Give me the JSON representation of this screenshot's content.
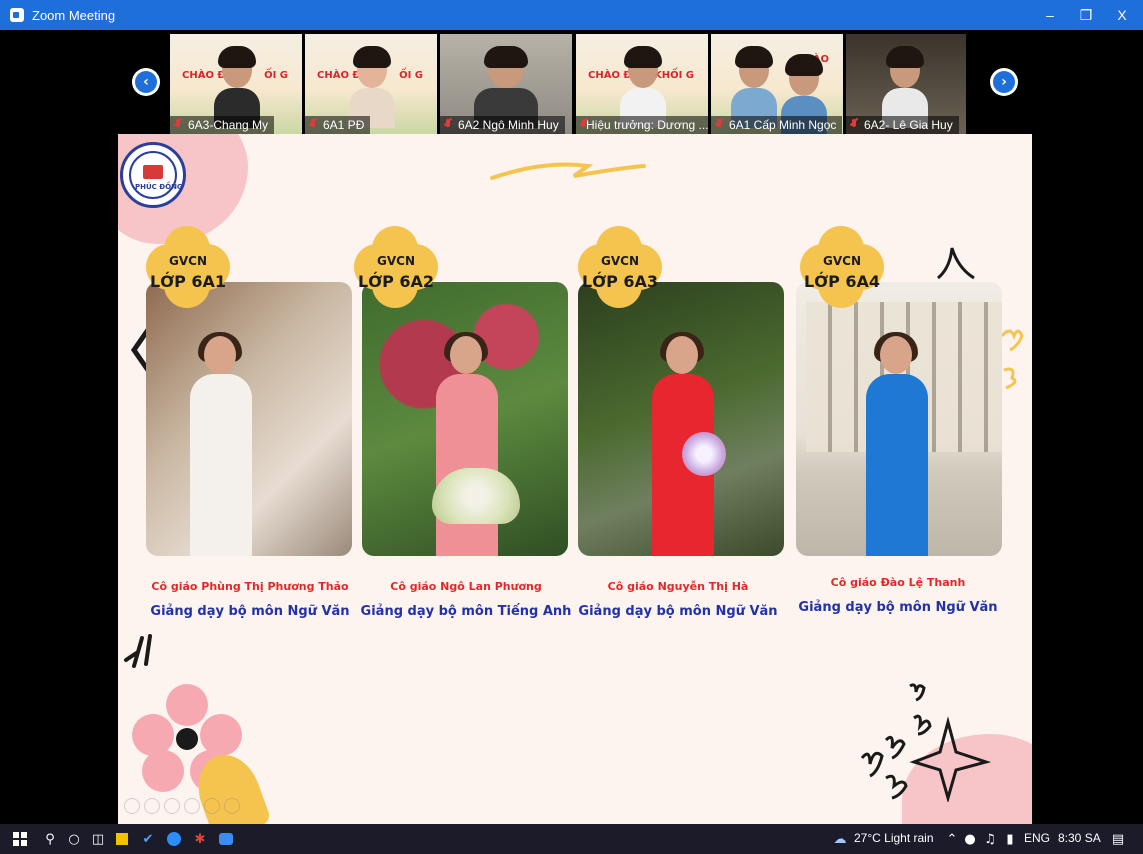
{
  "window": {
    "title": "Zoom Meeting"
  },
  "participants": [
    {
      "name": "6A3-Chang My",
      "banner": "CHÀO ĐÓ",
      "banner2": "ỐI G"
    },
    {
      "name": "6A1 PĐ",
      "banner": "CHÀO ĐÓ",
      "banner2": "ỐI G"
    },
    {
      "name": "6A2 Ngô Minh Huy",
      "banner": "",
      "banner2": ""
    },
    {
      "name": "Hiệu trưởng: Dương ...",
      "banner": "CHÀO ĐÓN",
      "banner2": "KHỐI G"
    },
    {
      "name": "6A1 Cấp Minh Ngọc",
      "banner": "",
      "banner2": "CHÀO"
    },
    {
      "name": "6A2- Lê Gia Huy",
      "banner": "",
      "banner2": ""
    }
  ],
  "slide": {
    "logo_text": "PHÚC ĐỒNG",
    "cards": [
      {
        "badge_top": "GVCN",
        "badge_class": "LỚP 6A1",
        "teacher": "Cô giáo Phùng Thị Phương Thảo",
        "subject": "Giảng dạy bộ môn Ngữ Văn",
        "dress": "#f4f1ec"
      },
      {
        "badge_top": "GVCN",
        "badge_class": "LỚP 6A2",
        "teacher": "Cô giáo Ngô Lan Phương",
        "subject": "Giảng dạy bộ môn Tiếng Anh",
        "dress": "#ef8f96"
      },
      {
        "badge_top": "GVCN",
        "badge_class": "LỚP 6A3",
        "teacher": "Cô giáo Nguyễn Thị Hà",
        "subject": "Giảng dạy bộ môn Ngữ Văn",
        "dress": "#e8262f"
      },
      {
        "badge_top": "GVCN",
        "badge_class": "LỚP 6A4",
        "teacher": "Cô giáo Đào Lệ Thanh",
        "subject": "Giảng dạy bộ môn Ngữ Văn",
        "dress": "#1f78d4"
      }
    ]
  },
  "taskbar": {
    "weather": "27°C  Light rain",
    "language": "ENG",
    "time": "8:30 SA"
  }
}
